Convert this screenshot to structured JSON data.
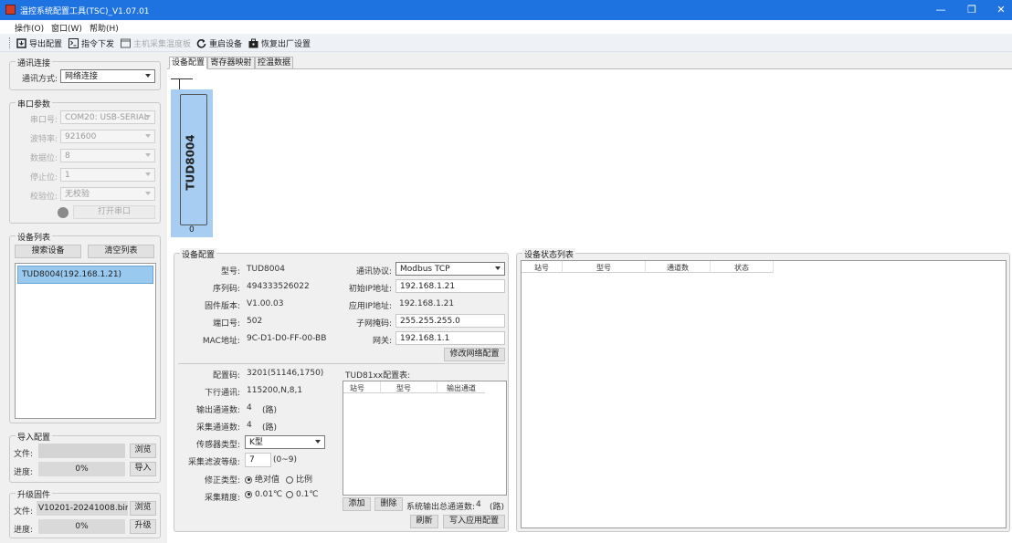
{
  "app": {
    "title": "温控系统配置工具(TSC)_V1.07.01"
  },
  "window_controls": {
    "minimize": "—",
    "restore": "❐",
    "close": "✕"
  },
  "menu": {
    "items": [
      "操作(O)",
      "窗口(W)",
      "帮助(H)"
    ]
  },
  "toolbar": {
    "items": [
      "导出配置",
      "指令下发",
      "主机采集温度板",
      "重启设备",
      "恢复出厂设置"
    ]
  },
  "comm": {
    "legend": "通讯连接",
    "method_label": "通讯方式:",
    "method_value": "网络连接"
  },
  "serial": {
    "legend": "串口参数",
    "port_label": "串口号:",
    "port_value": "COM20: USB-SERIAL",
    "baud_label": "波特率:",
    "baud_value": "921600",
    "data_label": "数据位:",
    "data_value": "8",
    "stop_label": "停止位:",
    "stop_value": "1",
    "parity_label": "校验位:",
    "parity_value": "无校验",
    "open_button": "打开串口"
  },
  "devices": {
    "legend": "设备列表",
    "search_button": "搜索设备",
    "clear_button": "清空列表",
    "items": [
      "TUD8004(192.168.1.21)"
    ]
  },
  "import": {
    "legend": "导入配置",
    "file_label": "文件:",
    "file_value": "",
    "browse_button": "浏览",
    "progress_label": "进度:",
    "progress_value": "0%",
    "import_button": "导入"
  },
  "upgrade": {
    "legend": "升级固件",
    "file_label": "文件:",
    "file_value": "V10201-20241008.bin",
    "browse_button": "浏览",
    "progress_label": "进度:",
    "progress_value": "0%",
    "upgrade_button": "升级"
  },
  "tabs": [
    "设备配置",
    "寄存器映射",
    "控温数据"
  ],
  "module": {
    "name": "TUD8004",
    "index": "0"
  },
  "config": {
    "legend": "设备配置",
    "model_label": "型号:",
    "model_value": "TUD8004",
    "serial_label": "序列码:",
    "serial_value": "494333526022",
    "fw_label": "固件版本:",
    "fw_value": "V1.00.03",
    "port_label": "端口号:",
    "port_value": "502",
    "mac_label": "MAC地址:",
    "mac_value": "9C-D1-D0-FF-00-BB",
    "proto_label": "通讯协议:",
    "proto_value": "Modbus TCP",
    "init_ip_label": "初始IP地址:",
    "init_ip_value": "192.168.1.21",
    "app_ip_label": "应用IP地址:",
    "app_ip_value": "192.168.1.21",
    "mask_label": "子网掩码:",
    "mask_value": "255.255.255.0",
    "gw_label": "网关:",
    "gw_value": "192.168.1.1",
    "modify_button": "修改网络配置",
    "code_label": "配置码:",
    "code_value": "3201(51146,1750)",
    "down_label": "下行通讯:",
    "down_value": "115200,N,8,1",
    "out_label": "输出通道数:",
    "out_value": "4",
    "out_unit": "(路)",
    "acq_label": "采集通道数:",
    "acq_value": "4",
    "acq_unit": "(路)",
    "sensor_label": "传感器类型:",
    "sensor_value": "K型",
    "filter_label": "采集滤波等级:",
    "filter_value": "7",
    "filter_range": "(0~9)",
    "corr_label": "修正类型:",
    "corr_opt1": "绝对值",
    "corr_opt2": "比例",
    "prec_label": "采集精度:",
    "prec_opt1": "0.01℃",
    "prec_opt2": "0.1℃",
    "tud_title": "TUD81xx配置表:",
    "tud_cols": [
      "站号",
      "型号",
      "输出通道"
    ],
    "add_button": "添加",
    "delete_button": "删除",
    "total_label": "系统输出总通道数:",
    "total_value": "4",
    "total_unit": "(路)",
    "refresh_button": "刷新",
    "write_button": "写入应用配置"
  },
  "status": {
    "legend": "设备状态列表",
    "cols": [
      "站号",
      "型号",
      "通道数",
      "状态"
    ]
  },
  "colors": {
    "titlebar": "#1e73e0",
    "selection": "#99c9ef",
    "module": "#a8cdf2"
  }
}
